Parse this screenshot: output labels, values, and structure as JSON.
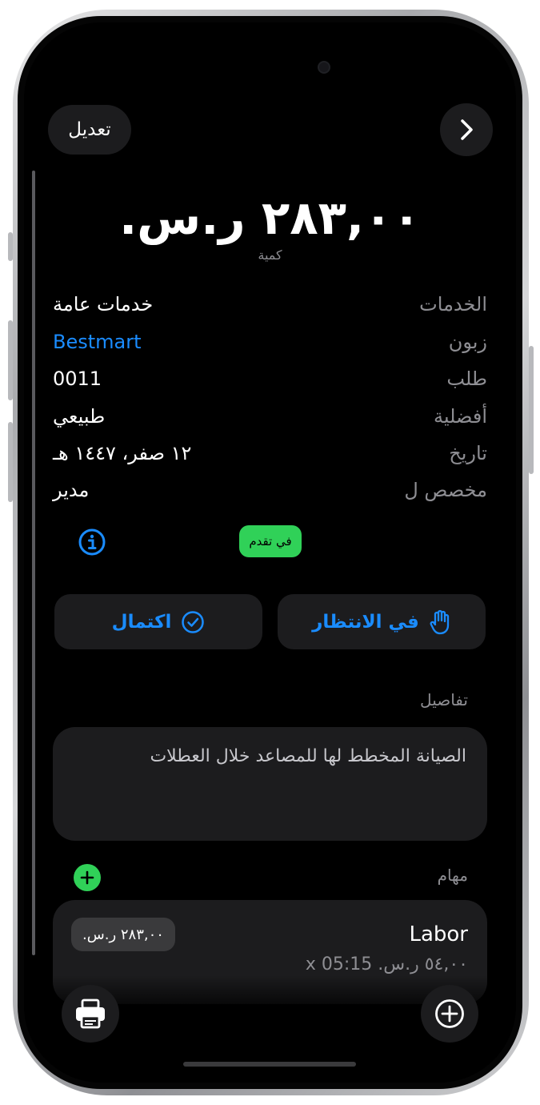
{
  "header": {
    "edit_label": "تعديل"
  },
  "summary": {
    "amount": "٢٨٣,٠٠ ر.س.",
    "amount_caption": "كمية"
  },
  "fields": [
    {
      "label": "الخدمات",
      "value": "خدمات عامة"
    },
    {
      "label": "زبون",
      "value": "Bestmart"
    },
    {
      "label": "طلب",
      "value": "0011"
    },
    {
      "label": "أفضلية",
      "value": "طبيعي"
    },
    {
      "label": "تاريخ",
      "value": "١٢ صفر، ١٤٤٧ هـ"
    },
    {
      "label": "مخصص ل",
      "value": "مدير"
    }
  ],
  "status": {
    "badge": "في تقدم"
  },
  "actions": {
    "complete_label": "اكتمال",
    "hold_label": "في الانتظار"
  },
  "details": {
    "label": "تفاصيل",
    "text": "الصيانة المخطط لها للمصاعد خلال العطلات"
  },
  "tasks": {
    "label": "مهام",
    "items": [
      {
        "name": "Labor",
        "rate_line": "٥٤,٠٠ ر.س. x 05:15",
        "total": "٢٨٣,٠٠ ر.س."
      }
    ]
  },
  "colors": {
    "accent": "#1a8cff",
    "success": "#30d158",
    "card": "#1c1c1e",
    "secondary_text": "#8e8e93"
  }
}
